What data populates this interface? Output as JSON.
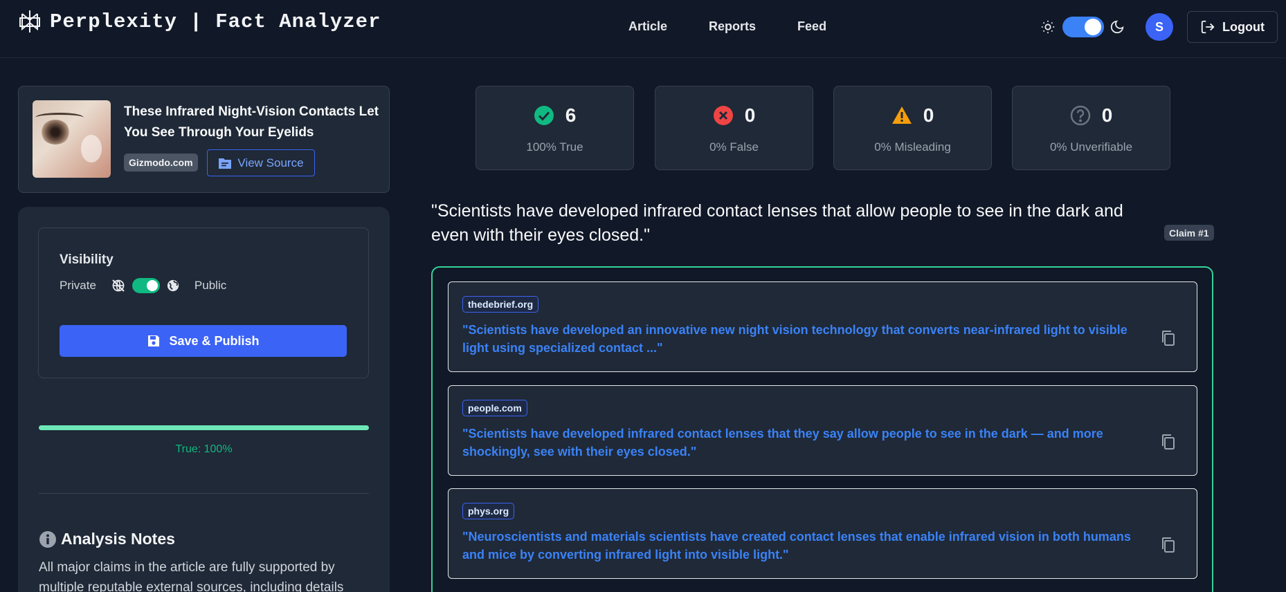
{
  "header": {
    "brand_title": "Perplexity | Fact Analyzer",
    "nav": [
      "Article",
      "Reports",
      "Feed"
    ],
    "avatar_initial": "S",
    "logout_label": "Logout",
    "accent_color": "#3b63f5"
  },
  "article": {
    "title": "These Infrared Night-Vision Contacts Let You See Through Your Eyelids",
    "source": "Gizmodo.com",
    "view_source_label": "View Source"
  },
  "visibility": {
    "title": "Visibility",
    "private_label": "Private",
    "public_label": "Public",
    "is_public": true,
    "save_label": "Save & Publish"
  },
  "truth_progress": {
    "value": 1.0,
    "label": "True: 100%",
    "color": "#6ee7b7"
  },
  "analysis_notes": {
    "title": "Analysis Notes",
    "text": "All major claims in the article are fully supported by multiple reputable external sources, including details"
  },
  "stats": [
    {
      "count": "6",
      "label": "100% True",
      "icon": "check-circle-icon",
      "color": "#10b981"
    },
    {
      "count": "0",
      "label": "0% False",
      "icon": "x-circle-icon",
      "color": "#ef4444"
    },
    {
      "count": "0",
      "label": "0% Misleading",
      "icon": "warning-icon",
      "color": "#f59e0b"
    },
    {
      "count": "0",
      "label": "0% Unverifiable",
      "icon": "question-circle-icon",
      "color": "#6b7280"
    }
  ],
  "claim": {
    "text": "\"Scientists have developed infrared contact lenses that allow people to see in the dark and even with their eyes closed.\"",
    "badge": "Claim #1",
    "evidence": [
      {
        "domain": "thedebrief.org",
        "quote": "\"Scientists have developed an innovative new night vision technology that converts near-infrared light to visible light using specialized contact ...\""
      },
      {
        "domain": "people.com",
        "quote": "\"Scientists have developed infrared contact lenses that they say allow people to see in the dark — and more shockingly, see with their eyes closed.\""
      },
      {
        "domain": "phys.org",
        "quote": "\"Neuroscientists and materials scientists have created contact lenses that enable infrared vision in both humans and mice by converting infrared light into visible light.\""
      }
    ]
  }
}
